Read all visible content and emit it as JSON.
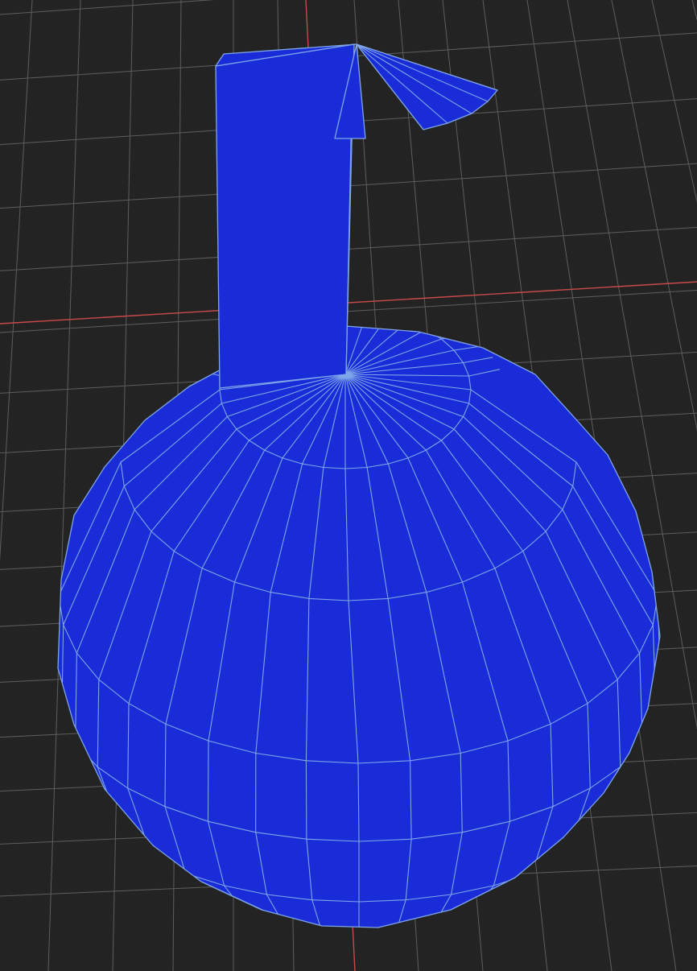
{
  "viewport": {
    "background_color": "#232323",
    "grid_line_color": "#5e5e5e",
    "x_axis_color": "#c94a4a",
    "y_axis_color": "#c94a4a",
    "grid_visible": true
  },
  "model": {
    "object": "mesh-object",
    "fill_color": "#192cd8",
    "wire_color": "#7fa6e8",
    "wireframe_visible": true,
    "shading": "flat",
    "parts": [
      "sphere-body",
      "rectangular-stem",
      "fan-leaf"
    ]
  }
}
